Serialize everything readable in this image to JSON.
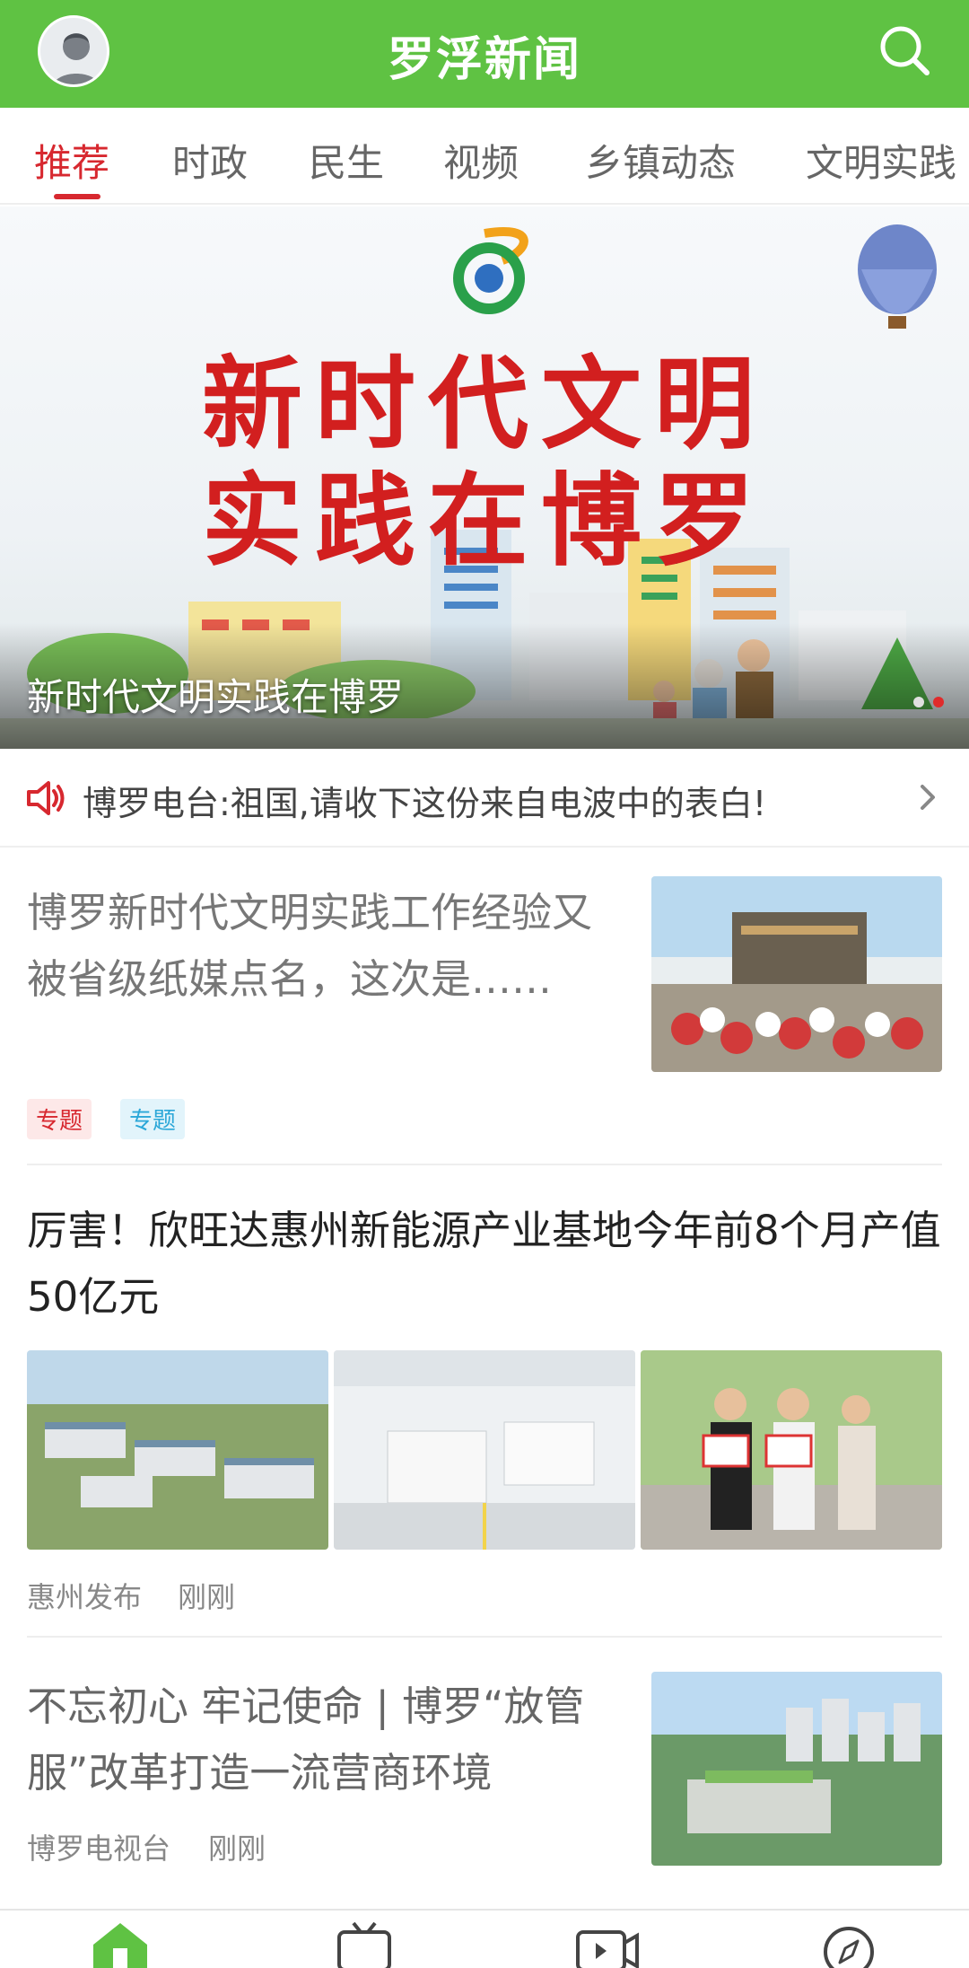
{
  "header": {
    "title": "罗浮新闻"
  },
  "tabs": [
    {
      "label": "推荐",
      "active": true
    },
    {
      "label": "时政"
    },
    {
      "label": "民生"
    },
    {
      "label": "视频"
    },
    {
      "label": "乡镇动态"
    },
    {
      "label": "文明实践"
    }
  ],
  "banner": {
    "headline_line1": "新时代文明",
    "headline_line2": "实践在博罗",
    "caption": "新时代文明实践在博罗",
    "slide_count": 2,
    "active_slide": 2
  },
  "notice": {
    "text": "博罗电台:祖国,请收下这份来自电波中的表白!"
  },
  "articles": [
    {
      "title": "博罗新时代文明实践工作经验又被省级纸媒点名，这次是……",
      "tags": [
        "专题",
        "专题"
      ]
    },
    {
      "title": "厉害！欣旺达惠州新能源产业基地今年前8个月产值50亿元",
      "source": "惠州发布",
      "time": "刚刚"
    },
    {
      "title": "不忘初心 牢记使命 | 博罗“放管服”改革打造一流营商环境",
      "source": "博罗电视台",
      "time": "刚刚"
    }
  ],
  "bottom_nav": [
    "home-icon",
    "tv-icon",
    "video-icon",
    "compass-icon"
  ],
  "colors": {
    "brand_green": "#5fc243",
    "accent_red": "#d7282f"
  }
}
